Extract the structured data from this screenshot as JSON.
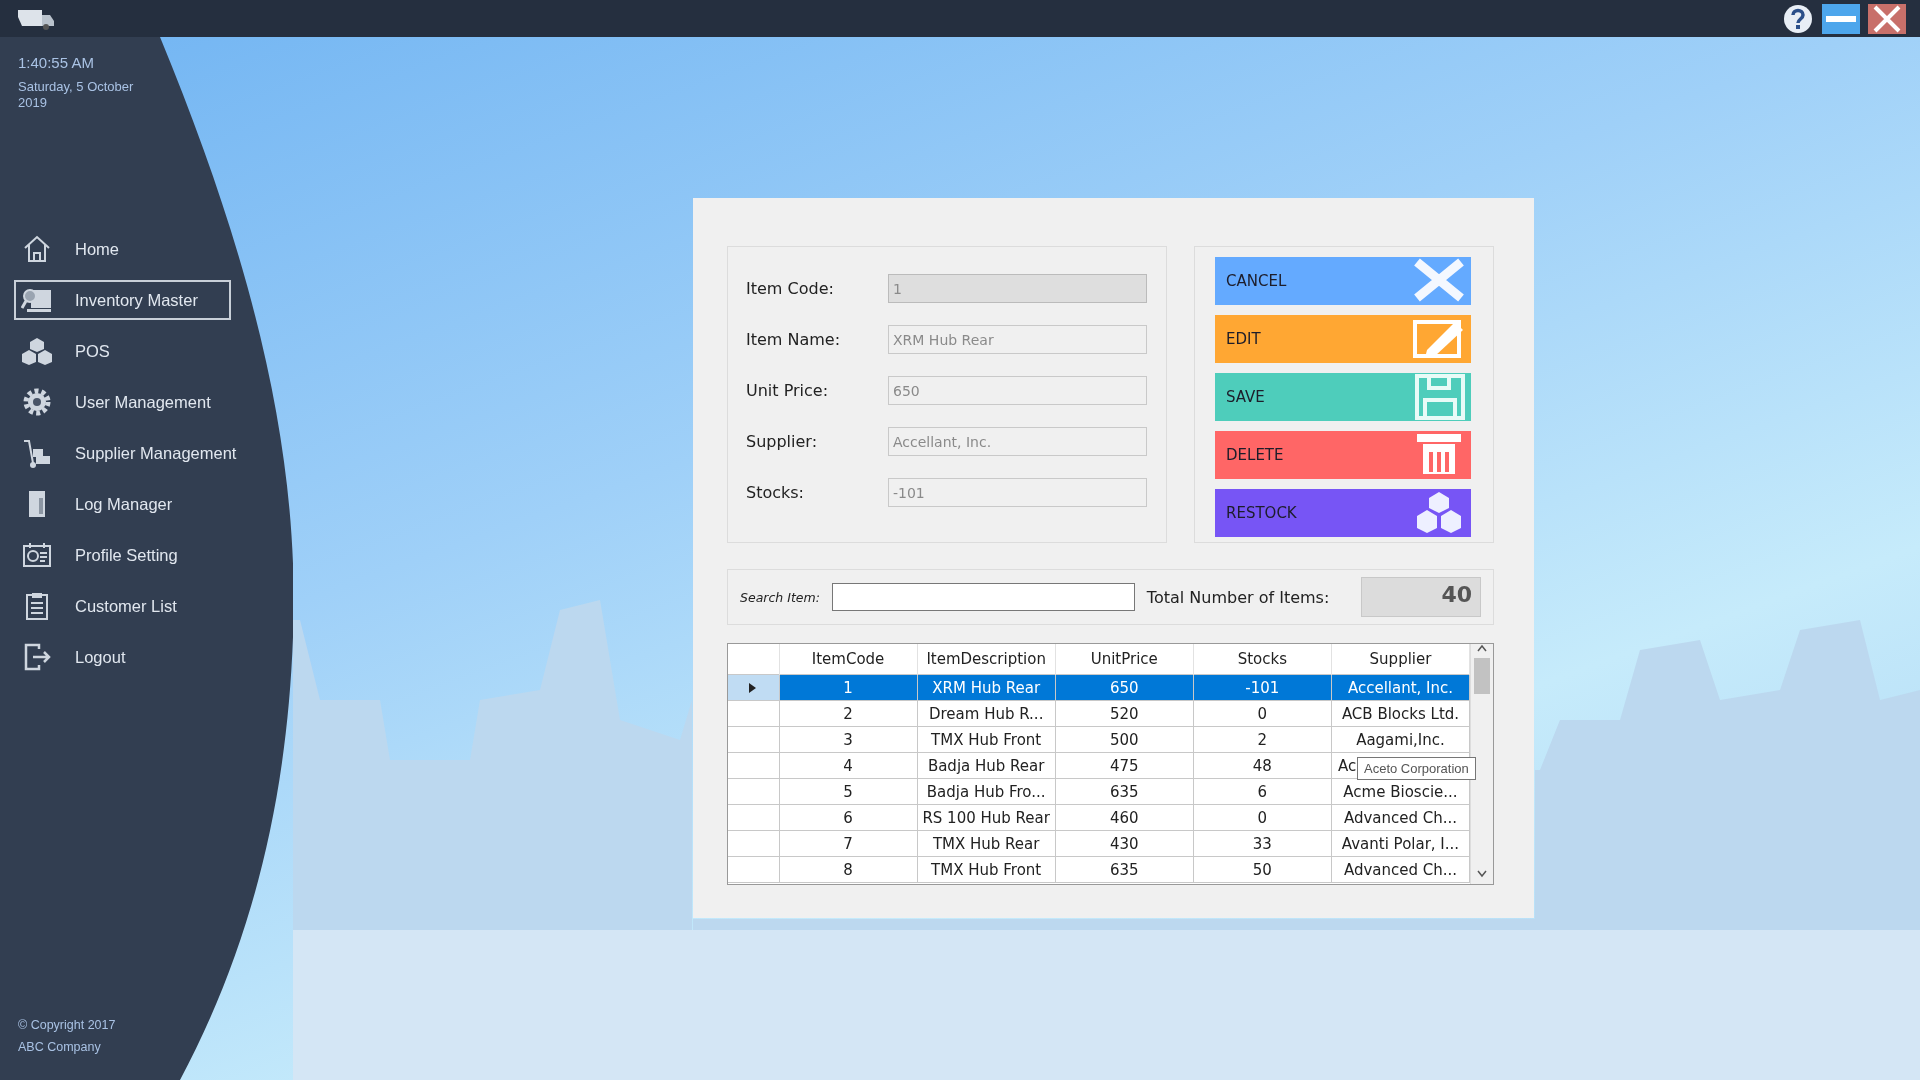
{
  "clock": {
    "time": "1:40:55 AM",
    "date": "Saturday, 5 October 2019"
  },
  "sidebar": {
    "items": [
      {
        "label": "Home",
        "selected": false
      },
      {
        "label": "Inventory Master",
        "selected": true
      },
      {
        "label": "POS",
        "selected": false
      },
      {
        "label": "User Management",
        "selected": false
      },
      {
        "label": "Supplier Management",
        "selected": false
      },
      {
        "label": "Log Manager",
        "selected": false
      },
      {
        "label": "Profile Setting",
        "selected": false
      },
      {
        "label": "Customer List",
        "selected": false
      },
      {
        "label": "Logout",
        "selected": false
      }
    ]
  },
  "footer": {
    "copyright": "© Copyright 2017",
    "company": "ABC Company"
  },
  "form": {
    "fields": [
      {
        "label": "Item Code:",
        "value": "1",
        "disabled": true
      },
      {
        "label": "Item Name:",
        "value": "XRM Hub Rear",
        "disabled": false
      },
      {
        "label": "Unit Price:",
        "value": "650",
        "disabled": false
      },
      {
        "label": "Supplier:",
        "value": "Accellant, Inc.",
        "disabled": false
      },
      {
        "label": "Stocks:",
        "value": "-101",
        "disabled": false
      }
    ]
  },
  "actions": [
    {
      "label": "CANCEL",
      "kind": "cancel",
      "color": "#64aaff"
    },
    {
      "label": "EDIT",
      "kind": "edit",
      "color": "#ffa733"
    },
    {
      "label": "SAVE",
      "kind": "save",
      "color": "#4ecdbb"
    },
    {
      "label": "DELETE",
      "kind": "delete",
      "color": "#ff6666"
    },
    {
      "label": "RESTOCK",
      "kind": "restock",
      "color": "#7755f5"
    }
  ],
  "search": {
    "label": "Search Item:"
  },
  "total": {
    "label": "Total Number of Items:",
    "value": "40"
  },
  "table": {
    "columns": [
      "ItemCode",
      "ItemDescription",
      "UnitPrice",
      "Stocks",
      "Supplier"
    ],
    "rows": [
      {
        "selected": true,
        "cells": [
          "1",
          "XRM Hub Rear",
          "650",
          "-101",
          "Accellant, Inc."
        ]
      },
      {
        "selected": false,
        "cells": [
          "2",
          "Dream Hub R...",
          "520",
          "0",
          "ACB Blocks Ltd."
        ]
      },
      {
        "selected": false,
        "cells": [
          "3",
          "TMX Hub Front",
          "500",
          "2",
          "Aagami,Inc."
        ]
      },
      {
        "selected": false,
        "cells": [
          "4",
          "Badja Hub Rear",
          "475",
          "48",
          "Ac"
        ]
      },
      {
        "selected": false,
        "cells": [
          "5",
          "Badja Hub Fro...",
          "635",
          "6",
          "Acme Bioscie..."
        ]
      },
      {
        "selected": false,
        "cells": [
          "6",
          "RS 100 Hub Rear",
          "460",
          "0",
          "Advanced Ch..."
        ]
      },
      {
        "selected": false,
        "cells": [
          "7",
          "TMX Hub Rear",
          "430",
          "33",
          "Avanti Polar, I..."
        ]
      },
      {
        "selected": false,
        "cells": [
          "8",
          "TMX Hub Front",
          "635",
          "50",
          "Advanced Ch..."
        ]
      }
    ],
    "tooltip": "Aceto Corporation"
  }
}
